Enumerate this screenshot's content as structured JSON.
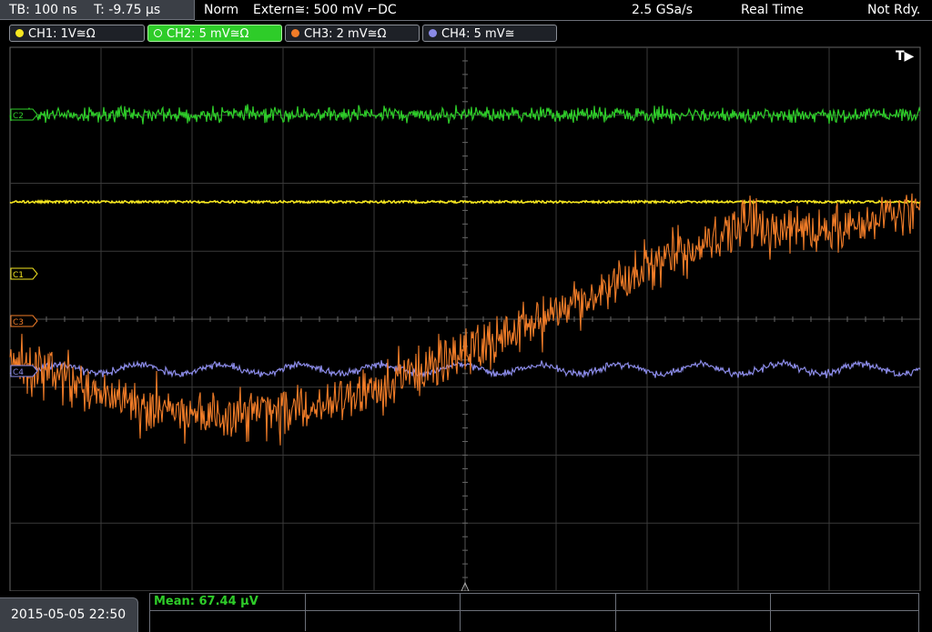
{
  "topbar": {
    "timebase": "TB: 100 ns",
    "trigger_offset": "T: -9.75 µs",
    "mode": "Norm",
    "trigger_source": "Extern≅: 500 mV ⌐DC",
    "sample_rate": "2.5 GSa/s",
    "acquisition": "Real Time",
    "status": "Not Rdy."
  },
  "channels": [
    {
      "label": "CH1: 1V≅Ω",
      "color": "#f5e620"
    },
    {
      "label": "CH2: 5 mV≅Ω",
      "color": "#2ecc29"
    },
    {
      "label": "CH3: 2 mV≅Ω",
      "color": "#f07c28"
    },
    {
      "label": "CH4: 5 mV≅",
      "color": "#8a8ae6"
    }
  ],
  "markers": {
    "trigger_pos": "T▶",
    "c1": "C1",
    "c2": "C2",
    "c3": "C3",
    "c4": "C4"
  },
  "bottom": {
    "datetime": "2015-05-05 22:50",
    "measurement": "Mean: 67.44 µV"
  },
  "colors": {
    "background": "#000000",
    "grid": "#3a3a3a",
    "panel": "#3b3f46"
  }
}
